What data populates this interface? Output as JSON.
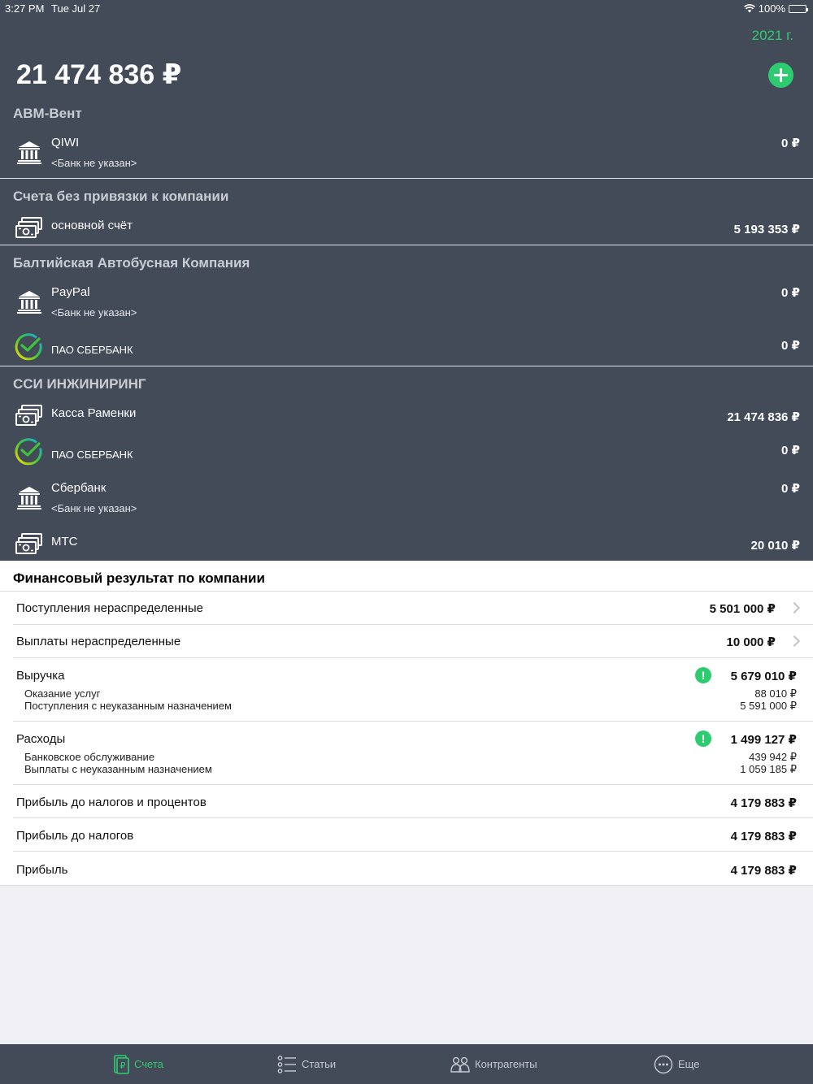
{
  "status": {
    "time": "3:27 PM",
    "date": "Tue Jul 27",
    "battery": "100%"
  },
  "header": {
    "year": "2021 г.",
    "total": "21 474 836 ₽"
  },
  "groups": [
    {
      "name": "АВМ-Вент",
      "accounts": [
        {
          "icon": "bank-icon",
          "name": "QIWI",
          "sub": "<Банк не указан>",
          "amount": "0 ₽"
        }
      ]
    },
    {
      "name": "Счета без привязки к компании",
      "accounts": [
        {
          "icon": "cash-icon",
          "name": "основной счёт",
          "amount": "5 193 353 ₽"
        }
      ]
    },
    {
      "name": "Балтийская Автобусная Компания",
      "accounts": [
        {
          "icon": "bank-icon",
          "name": "PayPal",
          "sub": "<Банк не указан>",
          "amount": "0 ₽"
        },
        {
          "icon": "sberbank-logo-icon",
          "name": "ПАО СБЕРБАНК",
          "amount": "0 ₽"
        }
      ]
    },
    {
      "name": "ССИ ИНЖИНИРИНГ",
      "accounts": [
        {
          "icon": "cash-icon",
          "name": "Касса Раменки",
          "amount": "21 474 836 ₽"
        },
        {
          "icon": "sberbank-logo-icon",
          "name": "ПАО СБЕРБАНК",
          "amount": "0 ₽"
        },
        {
          "icon": "bank-icon",
          "name": "Сбербанк",
          "sub": "<Банк не указан>",
          "amount": "0 ₽"
        },
        {
          "icon": "cash-icon",
          "name": "МТС",
          "amount": "20 010 ₽"
        }
      ]
    }
  ],
  "financial": {
    "title": "Финансовый результат по компании",
    "rows": [
      {
        "label": "Поступления нераспределенные",
        "amount": "5 501 000 ₽"
      },
      {
        "label": "Выплаты нераспределенные",
        "amount": "10 000 ₽"
      },
      {
        "label": "Выручка",
        "amount": "5 679 010 ₽",
        "warning": "!",
        "items": [
          {
            "label": "Оказание услуг",
            "amount": "88 010 ₽"
          },
          {
            "label": "Поступления с неуказанным назначением",
            "amount": "5 591 000 ₽"
          }
        ]
      },
      {
        "label": "Расходы",
        "amount": "1 499 127 ₽",
        "warning": "!",
        "items": [
          {
            "label": "Банковское обслуживание",
            "amount": "439 942 ₽"
          },
          {
            "label": "Выплаты с неуказанным назначением",
            "amount": "1 059 185 ₽"
          }
        ]
      },
      {
        "label": "Прибыль до налогов и процентов",
        "amount": "4 179 883 ₽"
      },
      {
        "label": "Прибыль до налогов",
        "amount": "4 179 883 ₽"
      },
      {
        "label": "Прибыль",
        "amount": "4 179 883 ₽"
      }
    ]
  },
  "tabs": [
    {
      "label": "Счета",
      "icon": "accounts-icon",
      "active": true
    },
    {
      "label": "Статьи",
      "icon": "list-icon",
      "active": false
    },
    {
      "label": "Контрагенты",
      "icon": "people-icon",
      "active": false
    },
    {
      "label": "Еще",
      "icon": "more-icon",
      "active": false
    }
  ],
  "colors": {
    "dark_bg": "#434a58",
    "accent": "#2ecc71",
    "page_bg": "#efeff4"
  }
}
